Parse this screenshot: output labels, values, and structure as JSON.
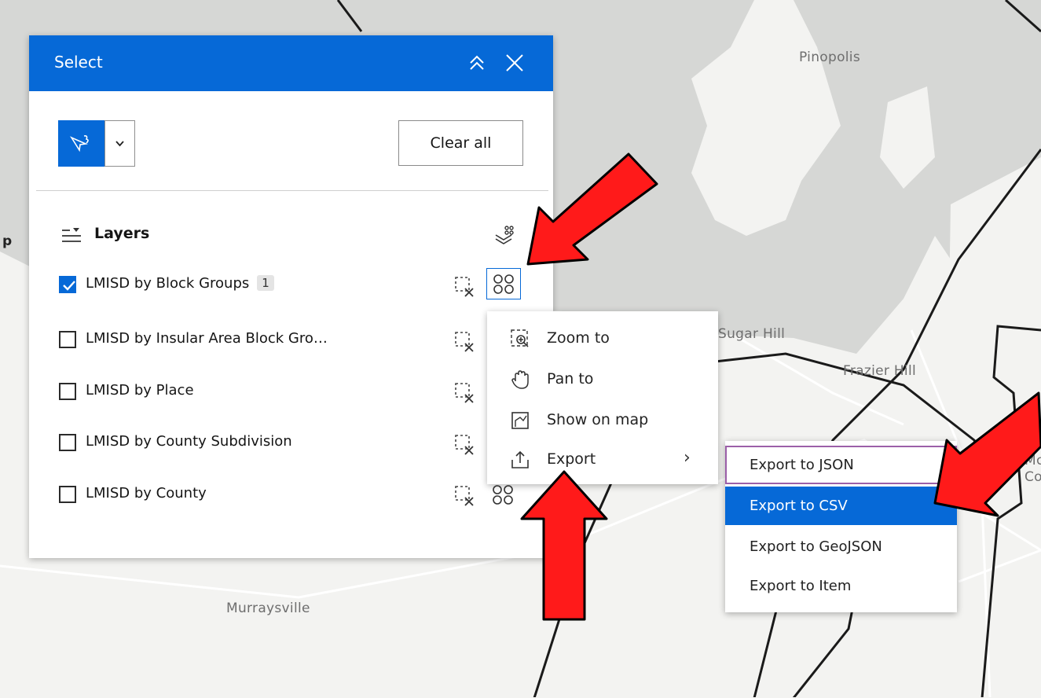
{
  "map": {
    "labels": [
      "Pinopolis",
      "Sugar Hill",
      "Frazier Hill",
      "Murraysville",
      "Mc",
      "Co",
      "p"
    ]
  },
  "panel": {
    "title": "Select",
    "clear_all_label": "Clear all",
    "layers_title": "Layers",
    "layers": [
      {
        "name": "LMISD by Block Groups",
        "checked": true,
        "count": "1"
      },
      {
        "name": "LMISD by Insular Area Block Gro…",
        "checked": false
      },
      {
        "name": "LMISD by Place",
        "checked": false
      },
      {
        "name": "LMISD by County Subdivision",
        "checked": false
      },
      {
        "name": "LMISD by County",
        "checked": false
      }
    ]
  },
  "action_menu": {
    "items": [
      {
        "label": "Zoom to",
        "icon": "zoom-to-icon"
      },
      {
        "label": "Pan to",
        "icon": "pan-hand-icon"
      },
      {
        "label": "Show on map",
        "icon": "show-on-map-icon"
      },
      {
        "label": "Export",
        "icon": "export-icon"
      }
    ],
    "submenu_arrow": "›"
  },
  "export_menu": {
    "items": [
      {
        "label": "Export to JSON",
        "state": "focused"
      },
      {
        "label": "Export to CSV",
        "state": "highlighted"
      },
      {
        "label": "Export to GeoJSON",
        "state": "normal"
      },
      {
        "label": "Export to Item",
        "state": "normal"
      }
    ]
  },
  "colors": {
    "accent": "#0669d7",
    "annotation_arrow": "#ff1a1a"
  }
}
